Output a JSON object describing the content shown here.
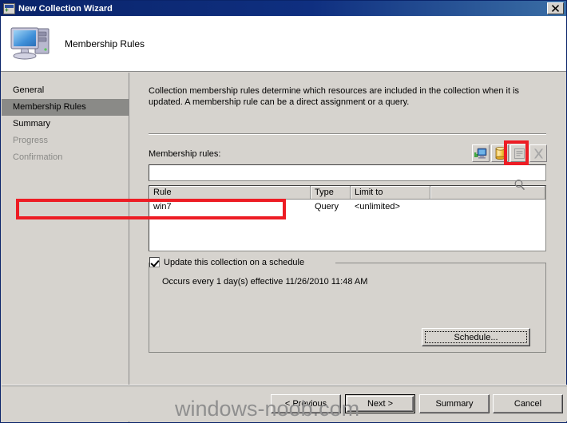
{
  "window": {
    "title": "New Collection Wizard",
    "title_icon": "wizard-window-icon",
    "close_label": "✕"
  },
  "header": {
    "title": "Membership Rules",
    "icon": "computer-icon"
  },
  "sidebar": {
    "items": [
      {
        "label": "General",
        "state": "normal"
      },
      {
        "label": "Membership Rules",
        "state": "selected"
      },
      {
        "label": "Summary",
        "state": "normal"
      },
      {
        "label": "Progress",
        "state": "disabled"
      },
      {
        "label": "Confirmation",
        "state": "disabled"
      }
    ]
  },
  "main": {
    "description": "Collection membership rules determine which resources are included in the collection when it is updated. A membership rule can be a direct assignment or a query.",
    "rules_label": "Membership rules:",
    "filter_value": "",
    "filter_placeholder": "",
    "search_icon": "magnifier-icon",
    "toolbar": [
      {
        "name": "direct-membership-rule-icon",
        "tooltip": "Direct membership rule",
        "enabled": true
      },
      {
        "name": "query-rule-icon",
        "tooltip": "Query rule",
        "enabled": true,
        "highlighted": true
      },
      {
        "name": "properties-icon",
        "tooltip": "Properties",
        "enabled": false
      },
      {
        "name": "delete-icon",
        "tooltip": "Delete",
        "enabled": false
      }
    ],
    "list": {
      "columns": [
        "Rule",
        "Type",
        "Limit to",
        ""
      ],
      "rows": [
        {
          "rule": "win7",
          "type": "Query",
          "limit_to": "<unlimited>",
          "highlighted": true
        }
      ]
    },
    "schedule": {
      "checkbox_label": "Update this collection on a schedule",
      "checked": true,
      "occurrence_text": "Occurs every 1 day(s) effective 11/26/2010 11:48 AM",
      "button_label": "Schedule..."
    }
  },
  "footer": {
    "buttons": [
      {
        "label": "< Previous",
        "default": false
      },
      {
        "label": "Next >",
        "default": true
      },
      {
        "label": "Summary",
        "default": false
      },
      {
        "label": "Cancel",
        "default": false
      }
    ]
  },
  "watermark": {
    "text": "windows-noob.com"
  },
  "colors": {
    "titlebar": "#0a246a",
    "face": "#d6d3ce",
    "highlight_red": "#ed1c24",
    "selected_item": "#8a8a87"
  }
}
